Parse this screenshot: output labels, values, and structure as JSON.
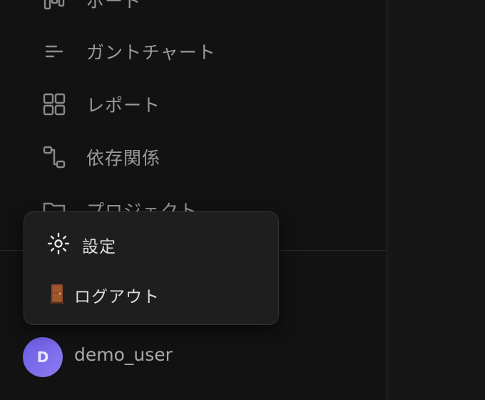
{
  "sidebar": {
    "nav_items": [
      {
        "label": "ボード",
        "icon": "kanban-board-icon"
      },
      {
        "label": "ガントチャート",
        "icon": "gantt-chart-icon"
      },
      {
        "label": "レポート",
        "icon": "grid-report-icon"
      },
      {
        "label": "依存関係",
        "icon": "dependency-flow-icon"
      },
      {
        "label": "プロジェクト",
        "icon": "folder-icon"
      }
    ]
  },
  "menu": {
    "settings_label": "設定",
    "settings_icon": "sun-gear-icon",
    "logout_label": "ログアウト",
    "logout_icon": "door-icon"
  },
  "user": {
    "avatar_initial": "D",
    "username": "demo_user"
  },
  "colors": {
    "avatar_start": "#6b5ce6",
    "avatar_end": "#8d7cf0",
    "door": "#a0522d"
  }
}
